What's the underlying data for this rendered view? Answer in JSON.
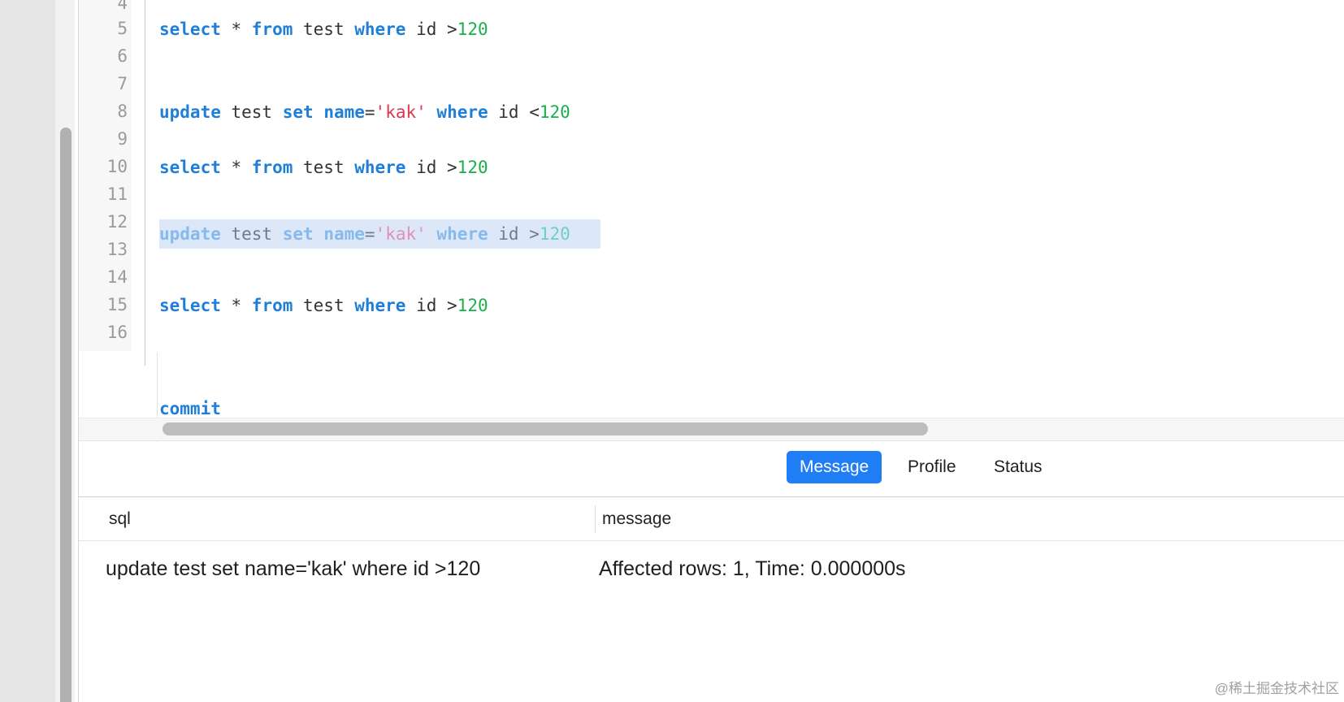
{
  "editor": {
    "line_numbers": [
      "4",
      "5",
      "6",
      "7",
      "8",
      "9",
      "10",
      "11",
      "12",
      "13",
      "14",
      "15",
      "16"
    ],
    "lines": [
      {
        "n": "5",
        "tokens": [
          [
            "kw",
            "select"
          ],
          [
            "plain",
            " * "
          ],
          [
            "kw",
            "from"
          ],
          [
            "plain",
            " test "
          ],
          [
            "kw",
            "where"
          ],
          [
            "plain",
            " id >"
          ],
          [
            "num",
            "120"
          ]
        ]
      },
      {
        "n": "8",
        "tokens": [
          [
            "kw",
            "update"
          ],
          [
            "plain",
            " test "
          ],
          [
            "kw",
            "set"
          ],
          [
            "plain",
            " "
          ],
          [
            "kw",
            "name"
          ],
          [
            "plain",
            "="
          ],
          [
            "str",
            "'kak'"
          ],
          [
            "plain",
            " "
          ],
          [
            "kw",
            "where"
          ],
          [
            "plain",
            " id <"
          ],
          [
            "num",
            "120"
          ]
        ]
      },
      {
        "n": "10",
        "tokens": [
          [
            "kw",
            "select"
          ],
          [
            "plain",
            " * "
          ],
          [
            "kw",
            "from"
          ],
          [
            "plain",
            " test "
          ],
          [
            "kw",
            "where"
          ],
          [
            "plain",
            " id >"
          ],
          [
            "num",
            "120"
          ]
        ]
      },
      {
        "n": "12",
        "selected": true,
        "tokens": [
          [
            "kw",
            "update"
          ],
          [
            "plain",
            " test "
          ],
          [
            "kw",
            "set"
          ],
          [
            "plain",
            " "
          ],
          [
            "kw",
            "name"
          ],
          [
            "plain",
            "="
          ],
          [
            "str",
            "'kak'"
          ],
          [
            "plain",
            " "
          ],
          [
            "kw",
            "where"
          ],
          [
            "plain",
            " id >"
          ],
          [
            "num",
            "120"
          ]
        ]
      },
      {
        "n": "15",
        "tokens": [
          [
            "kw",
            "select"
          ],
          [
            "plain",
            " * "
          ],
          [
            "kw",
            "from"
          ],
          [
            "plain",
            " test "
          ],
          [
            "kw",
            "where"
          ],
          [
            "plain",
            " id >"
          ],
          [
            "num",
            "120"
          ]
        ]
      },
      {
        "n": "",
        "tokens": [
          [
            "kw",
            "commit"
          ]
        ]
      }
    ]
  },
  "tabs": {
    "message": "Message",
    "profile": "Profile",
    "status": "Status"
  },
  "results": {
    "columns": {
      "sql": "sql",
      "message": "message"
    },
    "row": {
      "sql": "update test set name='kak' where id >120",
      "message": "Affected rows: 1, Time: 0.000000s"
    }
  },
  "watermark": "@稀土掘金技术社区",
  "colors": {
    "keyword": "#1f7fd8",
    "string": "#e0364f",
    "number": "#19b04b",
    "active_tab": "#1f7ef5"
  }
}
